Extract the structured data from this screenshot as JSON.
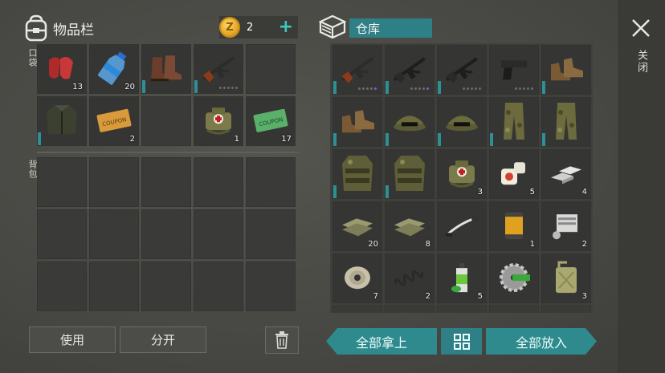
{
  "left_panel": {
    "title": "物品栏",
    "coins": "2",
    "add_symbol": "+",
    "pocket_label": "口袋",
    "backpack_label": "背包",
    "pocket_slots": [
      {
        "item": "red-cloth-icon",
        "qty": "13"
      },
      {
        "item": "water-bottle-icon",
        "qty": "20"
      },
      {
        "item": "boots-icon",
        "qty": "",
        "bar": true
      },
      {
        "item": "rifle-icon",
        "qty": "",
        "bar": true,
        "dots": [
          0,
          0,
          0,
          0,
          0
        ]
      },
      {
        "item": "",
        "qty": ""
      },
      {
        "item": "jacket-icon",
        "qty": "",
        "bar": true
      },
      {
        "item": "coupon-gold-icon",
        "qty": "2"
      },
      {
        "item": "",
        "qty": ""
      },
      {
        "item": "medkit-bag-icon",
        "qty": "1"
      },
      {
        "item": "coupon-green-icon",
        "qty": "17"
      }
    ],
    "backpack_slots": 15
  },
  "right_panel": {
    "title": "仓库",
    "storage_slots": [
      {
        "item": "rifle-icon",
        "qty": "",
        "bar": true,
        "dots": [
          0,
          0,
          0,
          0,
          1
        ]
      },
      {
        "item": "assault-rifle-icon",
        "qty": "",
        "bar": true,
        "dots": [
          0,
          0,
          0,
          0,
          1
        ]
      },
      {
        "item": "assault-rifle-icon",
        "qty": "",
        "bar": true,
        "dots": [
          0,
          0,
          0,
          0,
          0
        ]
      },
      {
        "item": "pistol-icon",
        "qty": "",
        "dots": [
          0,
          0,
          0,
          0,
          0
        ]
      },
      {
        "item": "boots-tan-icon",
        "qty": "",
        "bar": true
      },
      {
        "item": "boots-tan-icon",
        "qty": "",
        "bar": true
      },
      {
        "item": "camo-cap-icon",
        "qty": "",
        "bar": true
      },
      {
        "item": "camo-cap-icon",
        "qty": "",
        "bar": true
      },
      {
        "item": "camo-pants-icon",
        "qty": "",
        "bar": true
      },
      {
        "item": "camo-pants-icon",
        "qty": "",
        "bar": true
      },
      {
        "item": "camo-vest-icon",
        "qty": "",
        "bar": true
      },
      {
        "item": "camo-vest-icon",
        "qty": "",
        "bar": true
      },
      {
        "item": "medkit-bag-icon",
        "qty": "3"
      },
      {
        "item": "bandage-icon",
        "qty": "5"
      },
      {
        "item": "metal-bars-icon",
        "qty": "4"
      },
      {
        "item": "cloth-pile-icon",
        "qty": "20"
      },
      {
        "item": "cloth-pile-icon",
        "qty": "8"
      },
      {
        "item": "handlebar-icon",
        "qty": ""
      },
      {
        "item": "oil-filter-icon",
        "qty": "1"
      },
      {
        "item": "engine-part-icon",
        "qty": "2"
      },
      {
        "item": "wire-spool-icon",
        "qty": "7"
      },
      {
        "item": "spring-icon",
        "qty": "2"
      },
      {
        "item": "spray-can-icon",
        "qty": "5"
      },
      {
        "item": "saw-blade-icon",
        "qty": ""
      },
      {
        "item": "jerrycan-icon",
        "qty": "3"
      },
      {
        "item": "",
        "qty": ""
      },
      {
        "item": "",
        "qty": ""
      },
      {
        "item": "",
        "qty": ""
      },
      {
        "item": "",
        "qty": ""
      },
      {
        "item": "",
        "qty": ""
      }
    ]
  },
  "close_label": "关闭",
  "buttons": {
    "use": "使用",
    "split": "分开",
    "take_all": "全部拿上",
    "put_all": "全部放入"
  }
}
